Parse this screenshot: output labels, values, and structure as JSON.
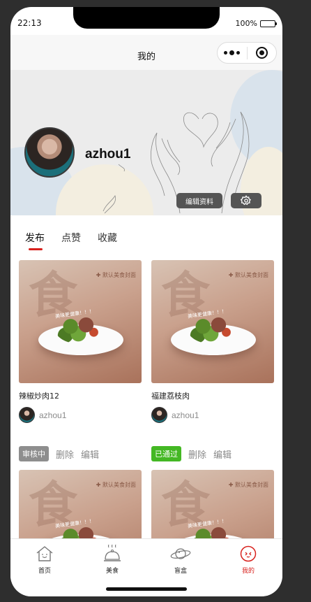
{
  "status_bar": {
    "time": "22:13",
    "battery": "100%",
    "battery_level": 1.0
  },
  "navbar": {
    "title": "我的",
    "more_icon": "more-dots-icon",
    "close_icon": "capsule-close-icon"
  },
  "profile": {
    "username": "azhou1",
    "edit_label": "编辑资料",
    "settings_icon": "gear-icon"
  },
  "tabs": [
    {
      "label": "发布",
      "active": true
    },
    {
      "label": "点赞",
      "active": false
    },
    {
      "label": "收藏",
      "active": false
    }
  ],
  "thumbnail": {
    "glyph": "食",
    "tag": "✚ 默认美食封面",
    "slogan": "美味更健康！！！"
  },
  "posts": [
    {
      "title": "辣椒炒肉12",
      "author": "azhou1"
    },
    {
      "title": "福建荔枝肉",
      "author": "azhou1"
    },
    {
      "status": "审核中",
      "actions": [
        "删除",
        "编辑"
      ]
    },
    {
      "status": "已通过",
      "actions": [
        "删除",
        "编辑"
      ]
    }
  ],
  "tabbar": [
    {
      "label": "首页",
      "icon": "home-icon",
      "active": false
    },
    {
      "label": "美食",
      "icon": "cloche-icon",
      "active": false
    },
    {
      "label": "盲盒",
      "icon": "planet-icon",
      "active": false
    },
    {
      "label": "我的",
      "icon": "profile-icon",
      "active": true
    }
  ],
  "colors": {
    "accent": "#d8201c",
    "approved": "#44b824",
    "pending": "#8e8e8e"
  }
}
